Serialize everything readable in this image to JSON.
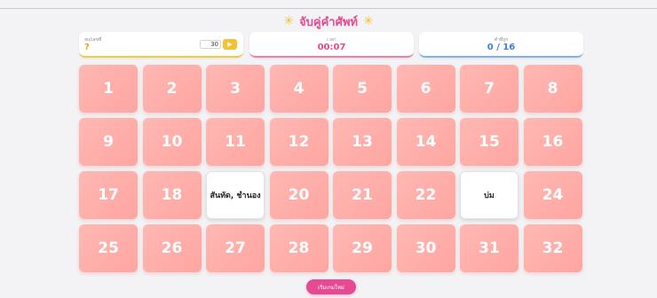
{
  "title": {
    "star_left": "✳",
    "text": "จับคู่คำศัพท์",
    "star_right": "✳"
  },
  "stats": {
    "pairs": {
      "label": "จบ/เลขที่",
      "value": "?",
      "input_value": "30",
      "button_icon": "▶"
    },
    "time": {
      "label": "เวลา",
      "value": "00:07"
    },
    "score": {
      "label": "คำที่ถูก",
      "value": "0 / 16"
    }
  },
  "cards": [
    {
      "label": "1",
      "open": false
    },
    {
      "label": "2",
      "open": false
    },
    {
      "label": "3",
      "open": false
    },
    {
      "label": "4",
      "open": false
    },
    {
      "label": "5",
      "open": false
    },
    {
      "label": "6",
      "open": false
    },
    {
      "label": "7",
      "open": false
    },
    {
      "label": "8",
      "open": false
    },
    {
      "label": "9",
      "open": false
    },
    {
      "label": "10",
      "open": false
    },
    {
      "label": "11",
      "open": false
    },
    {
      "label": "12",
      "open": false
    },
    {
      "label": "13",
      "open": false
    },
    {
      "label": "14",
      "open": false
    },
    {
      "label": "15",
      "open": false
    },
    {
      "label": "16",
      "open": false
    },
    {
      "label": "17",
      "open": false
    },
    {
      "label": "18",
      "open": false
    },
    {
      "label": "สันทัด, ชำนอง",
      "open": true
    },
    {
      "label": "20",
      "open": false
    },
    {
      "label": "21",
      "open": false
    },
    {
      "label": "22",
      "open": false
    },
    {
      "label": "บ่ม",
      "open": true
    },
    {
      "label": "24",
      "open": false
    },
    {
      "label": "25",
      "open": false
    },
    {
      "label": "26",
      "open": false
    },
    {
      "label": "27",
      "open": false
    },
    {
      "label": "28",
      "open": false
    },
    {
      "label": "29",
      "open": false
    },
    {
      "label": "30",
      "open": false
    },
    {
      "label": "31",
      "open": false
    },
    {
      "label": "32",
      "open": false
    }
  ],
  "new_game_label": "เริ่มเกมใหม่",
  "colors": {
    "card_back": "#ffaaa6",
    "accent_pink": "#e64a92",
    "accent_yellow": "#f2c233",
    "accent_blue": "#3c7fd6"
  }
}
